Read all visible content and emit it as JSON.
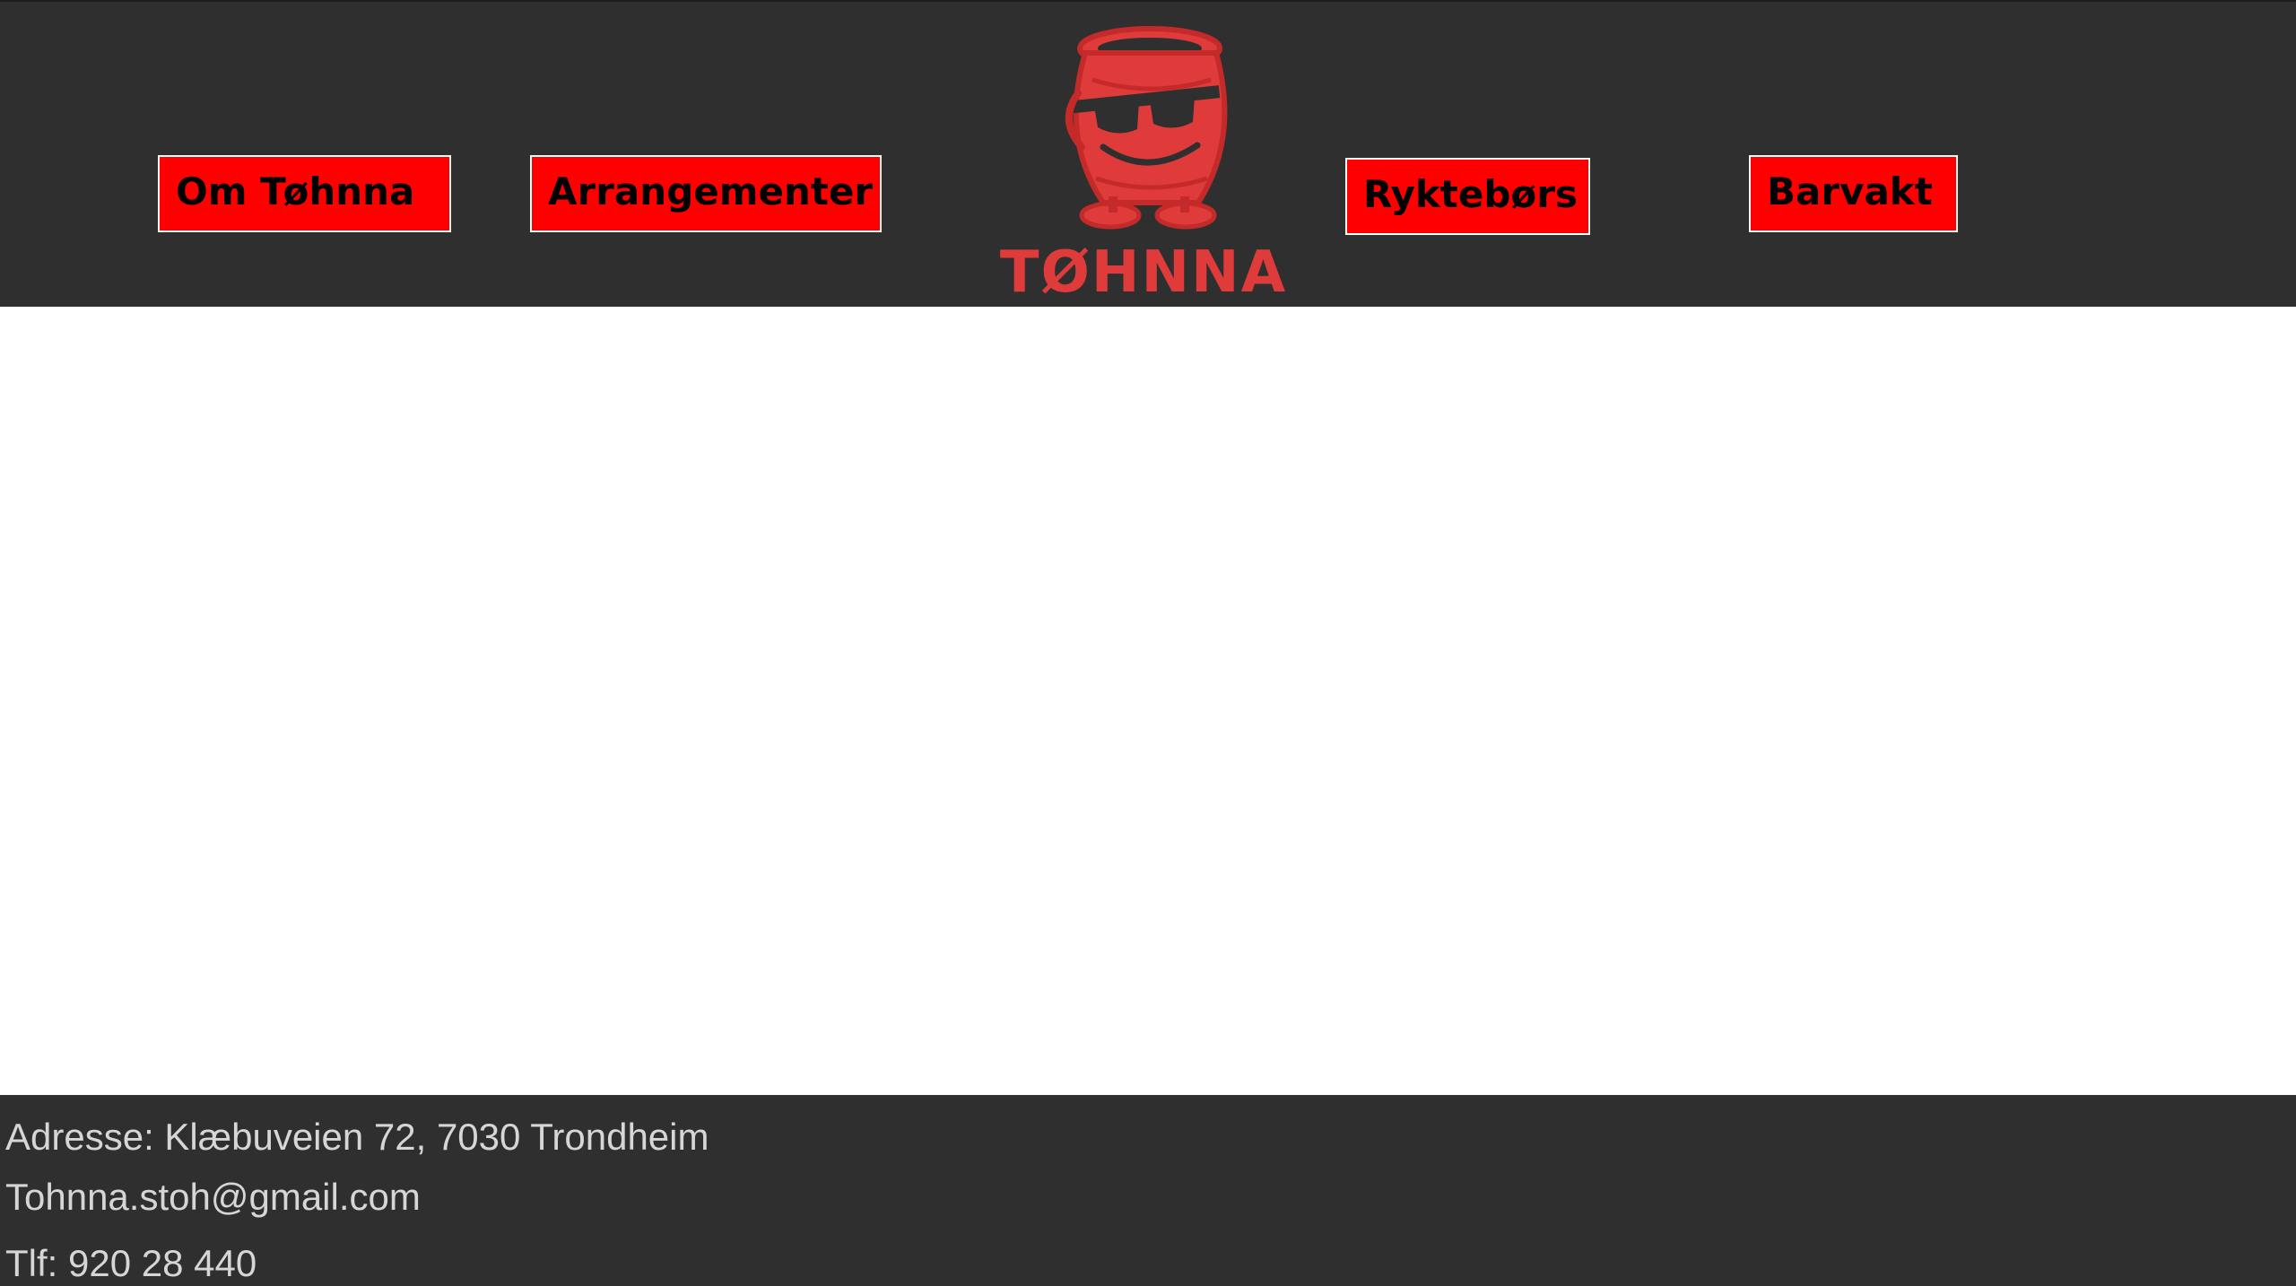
{
  "header": {
    "brand": "TØHNNA",
    "logo_icon": "barrel-mascot-with-sunglasses-icon",
    "brand_color": "#e03b3b",
    "nav": [
      {
        "label": "Om Tøhnna"
      },
      {
        "label": "Arrangementer"
      },
      {
        "label": "Ryktebørs"
      },
      {
        "label": "Barvakt"
      }
    ],
    "nav_bg_color": "#ff0000"
  },
  "footer": {
    "address": "Adresse: Klæbuveien 72, 7030 Trondheim",
    "email": "Tohnna.stoh@gmail.com",
    "phone": "Tlf: 920 28 440"
  },
  "colors": {
    "header_bg": "#2f2f2f",
    "footer_bg": "#2f2f2f",
    "footer_text": "#d6d6d6"
  }
}
